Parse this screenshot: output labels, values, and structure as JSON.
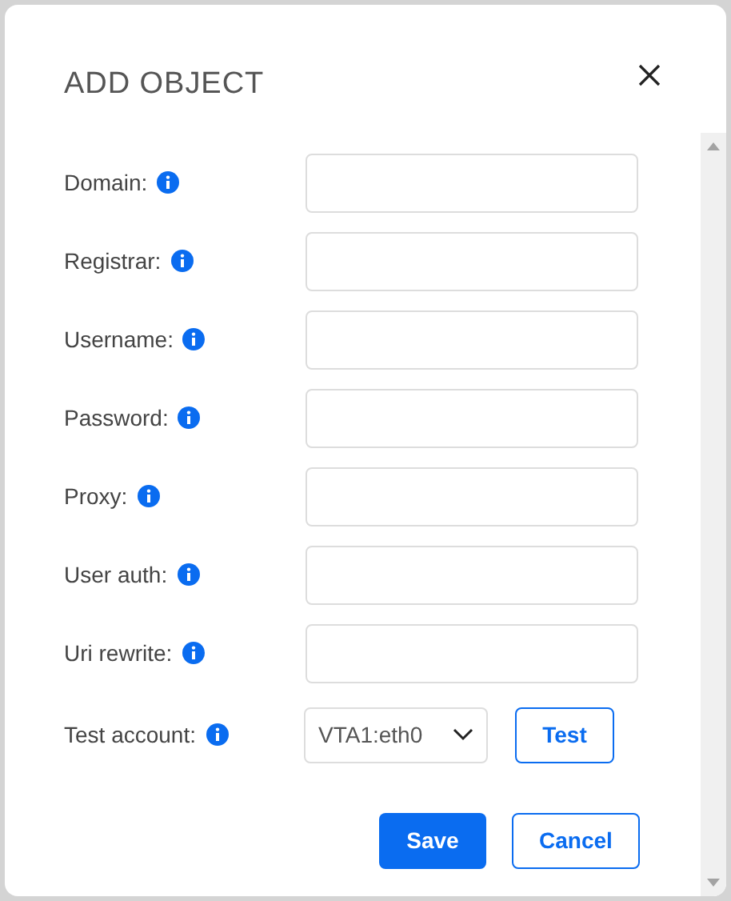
{
  "dialog": {
    "title": "ADD OBJECT"
  },
  "fields": [
    {
      "kind": "text",
      "label": "Domain:"
    },
    {
      "kind": "text",
      "label": "Registrar:"
    },
    {
      "kind": "text",
      "label": "Username:"
    },
    {
      "kind": "text",
      "label": "Password:"
    },
    {
      "kind": "text",
      "label": "Proxy:"
    },
    {
      "kind": "text",
      "label": "User auth:"
    },
    {
      "kind": "text",
      "label": "Uri rewrite:"
    },
    {
      "kind": "select",
      "label": "Test account:",
      "value": "VTA1:eth0",
      "button": "Test"
    }
  ],
  "buttons": [
    {
      "label": "Save",
      "kind": "primary"
    },
    {
      "label": "Cancel",
      "kind": "secondary"
    }
  ]
}
